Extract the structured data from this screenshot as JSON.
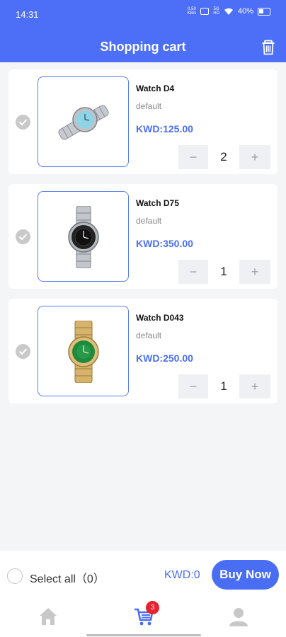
{
  "status_bar": {
    "time": "14:31",
    "data_speed_top": "0.50",
    "data_speed_bottom": "KB/s",
    "network_top": "5G",
    "network_bottom": "HD",
    "battery": "40%"
  },
  "header": {
    "title": "Shopping cart",
    "delete_icon": "trash-icon"
  },
  "cart_items": [
    {
      "name": "Watch D4",
      "variant": "default",
      "price": "KWD:125.00",
      "quantity": "2",
      "checked": true
    },
    {
      "name": "Watch D75",
      "variant": "default",
      "price": "KWD:350.00",
      "quantity": "1",
      "checked": true
    },
    {
      "name": "Watch D043",
      "variant": "default",
      "price": "KWD:250.00",
      "quantity": "1",
      "checked": true
    }
  ],
  "stepper": {
    "minus": "−",
    "plus": "+"
  },
  "checkout": {
    "select_all": "Select all（0）",
    "total": "KWD:0",
    "buy_now": "Buy Now"
  },
  "tab_bar": {
    "items": [
      {
        "icon": "home-icon",
        "active": false
      },
      {
        "icon": "cart-icon",
        "active": true,
        "badge": "3"
      },
      {
        "icon": "user-icon",
        "active": false
      }
    ]
  },
  "colors": {
    "accent": "#4a6ef3",
    "header": "#4d6ff7",
    "badge": "#e6232f"
  }
}
